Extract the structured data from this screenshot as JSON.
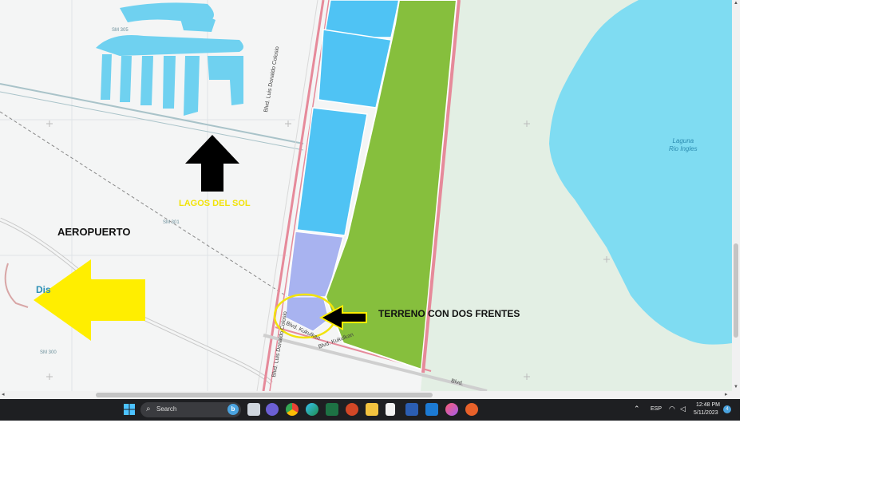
{
  "map": {
    "labels": {
      "airport": "AEROPUERTO",
      "lagos_del_sol": "LAGOS DEL SOL",
      "terreno": "TERRENO CON DOS FRENTES",
      "laguna_line1": "Laguna",
      "laguna_line2": "Rio Ingles",
      "dis": "Dis",
      "sm305": "SM 305",
      "sm301": "SM 301",
      "sm300": "SM 300",
      "blvd_colosio_top": "Blvd. Luis Donaldo Colosio",
      "blvd_colosio_bottom": "Blvd. Luis Donaldo Colosio",
      "blvd_kukulkan": "Blvd. Kukulkan",
      "blvd_kukulkan_2": "Blvd. Kukulkan",
      "blvd_short": "Blvd."
    },
    "colors": {
      "lot_blue": "#4fc3f4",
      "lot_lavender": "#a8b3f0",
      "lot_green": "#86bf3d",
      "lake": "#7fdcf2",
      "road_border": "#e68a9a",
      "arrow_yellow": "#ffee00",
      "arrow_black": "#000000",
      "highlight_circle": "#f2e30a"
    }
  },
  "taskbar": {
    "search_placeholder": "Search",
    "bing_letter": "b",
    "language": "ESP",
    "time": "12:48 PM",
    "date": "5/11/2023",
    "notification_count": "4",
    "apps": [
      "start",
      "search",
      "task-view",
      "widgets",
      "chrome",
      "edge",
      "excel",
      "powerpoint",
      "file-explorer",
      "notepad",
      "word",
      "mail",
      "itunes",
      "acrobat"
    ]
  }
}
